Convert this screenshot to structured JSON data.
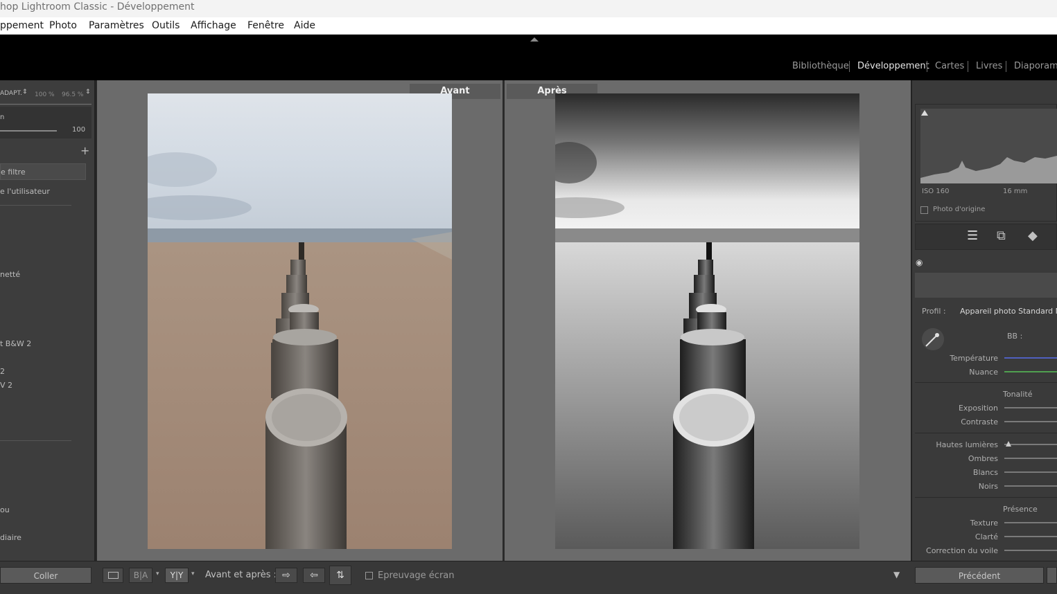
{
  "window": {
    "title": "hop Lightroom Classic - Développement"
  },
  "menubar": {
    "items": [
      "ppement",
      "Photo",
      "Paramètres",
      "Outils",
      "Affichage",
      "Fenêtre",
      "Aide"
    ]
  },
  "modules": {
    "items": [
      "Bibliothèque",
      "Développement",
      "Cartes",
      "Livres",
      "Diaporama"
    ],
    "active": "Développement"
  },
  "left_panel": {
    "nav_label": "ADAPT.",
    "zoom_1": "100 %",
    "zoom_2": "96.5 %",
    "slider_label": "n",
    "slider_value": "100",
    "filter_label": "e filtre",
    "user_presets": "e l'utilisateur",
    "items": [
      "netté",
      "t B&W 2",
      "2",
      "V 2",
      "ou",
      "diaire"
    ],
    "paste_button": "Coller"
  },
  "view": {
    "before_label": "Avant",
    "after_label": "Après"
  },
  "right_panel": {
    "iso": "ISO 160",
    "focal": "16 mm",
    "original_photo": "Photo d'origine",
    "profile_label": "Profil :",
    "profile_value": "Appareil photo Standard N&B",
    "wb_label": "BB :",
    "temperature": "Température",
    "tint": "Nuance",
    "tone_header": "Tonalité",
    "exposure": "Exposition",
    "contrast": "Contraste",
    "highlights": "Hautes lumières",
    "shadows": "Ombres",
    "whites": "Blancs",
    "blacks": "Noirs",
    "presence_header": "Présence",
    "texture": "Texture",
    "clarity": "Clarté",
    "dehaze": "Correction du voile",
    "previous_button": "Précédent"
  },
  "toolbar": {
    "before_after_label": "Avant et après :",
    "soft_proof": "Epreuvage écran",
    "ba_icon_1": "B|A",
    "ba_icon_2": "Y|Y"
  },
  "icons": [
    "eye-icon",
    "sliders-icon",
    "crop-icon",
    "eraser-icon",
    "eyedropper-icon",
    "plus-icon",
    "dropdown-arrow-icon"
  ]
}
